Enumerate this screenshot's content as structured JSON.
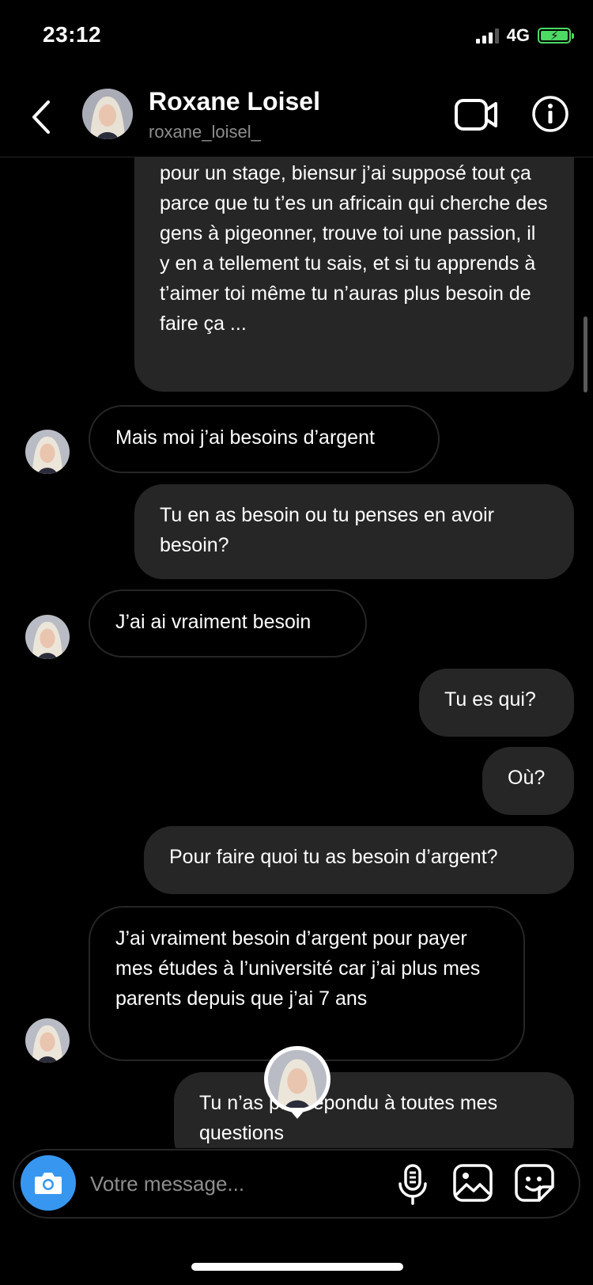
{
  "status_bar": {
    "time": "23:12",
    "network": "4G"
  },
  "header": {
    "name": "Roxane Loisel",
    "handle": "roxane_loisel_",
    "back_icon": "chevron-left-icon",
    "video_icon": "video-camera-icon",
    "info_icon": "info-icon"
  },
  "messages": [
    {
      "from": "me",
      "text": "pour un stage, biensur j’ai supposé tout ça parce que tu t’es un africain qui cherche des gens à pigeonner, trouve toi une passion, il y en a tellement tu sais, et si tu apprends à t’aimer toi même tu n’auras plus besoin de faire ça ..."
    },
    {
      "from": "them",
      "text": "Mais moi j’ai besoins d’argent"
    },
    {
      "from": "me",
      "text": "Tu en as besoin ou tu penses en avoir besoin?"
    },
    {
      "from": "them",
      "text": "J’ai ai vraiment besoin"
    },
    {
      "from": "me",
      "text": "Tu es qui?"
    },
    {
      "from": "me",
      "text": "Où?"
    },
    {
      "from": "me",
      "text": "Pour faire quoi tu as besoin d’argent?"
    },
    {
      "from": "them",
      "text": "J’ai vraiment besoin d’argent pour payer mes études à l’université car j’ai plus mes parents depuis que j’ai 7 ans"
    },
    {
      "from": "me",
      "text": "Tu n’as pas répondu à toutes mes questions"
    }
  ],
  "composer": {
    "placeholder": "Votre message...",
    "camera_icon": "camera-icon",
    "mic_icon": "microphone-icon",
    "gallery_icon": "image-icon",
    "sticker_icon": "sticker-icon"
  },
  "colors": {
    "background": "#000000",
    "sent_bubble": "#262626",
    "accent_blue": "#3797f0",
    "battery_green": "#4cd964",
    "muted_text": "#8e8e8e"
  }
}
